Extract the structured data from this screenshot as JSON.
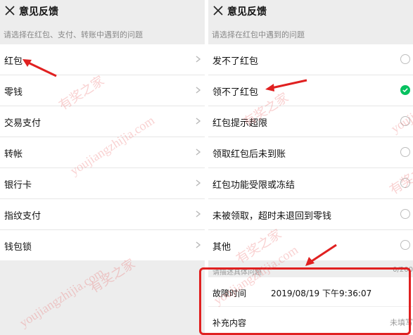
{
  "left": {
    "title": "意见反馈",
    "subtitle": "请选择在红包、支付、转账中遇到的问题",
    "items": [
      {
        "label": "红包"
      },
      {
        "label": "零钱"
      },
      {
        "label": "交易支付"
      },
      {
        "label": "转帐"
      },
      {
        "label": "银行卡"
      },
      {
        "label": "指纹支付"
      },
      {
        "label": "钱包锁"
      }
    ]
  },
  "right": {
    "title": "意见反馈",
    "subtitle": "请选择在红包中遇到的问题",
    "items": [
      {
        "label": "发不了红包",
        "selected": false
      },
      {
        "label": "领不了红包",
        "selected": true
      },
      {
        "label": "红包提示超限",
        "selected": false
      },
      {
        "label": "领取红包后未到账",
        "selected": false
      },
      {
        "label": "红包功能受限或冻结",
        "selected": false
      },
      {
        "label": "未被领取，超时未退回到零钱",
        "selected": false
      },
      {
        "label": "其他",
        "selected": false
      }
    ],
    "detail_hint": "请描述具体问题",
    "detail_count": "0/200",
    "fault_time_label": "故障时间",
    "fault_time_value": "2019/08/19 下午9:36:07",
    "supplement_label": "补充内容",
    "supplement_placeholder": "未填写"
  },
  "watermark": {
    "cn": "有奖之家",
    "en": "youjiangzhijia.com"
  },
  "colors": {
    "accent_green": "#07c160",
    "annotation_red": "#e02020",
    "background": "#ededed"
  }
}
